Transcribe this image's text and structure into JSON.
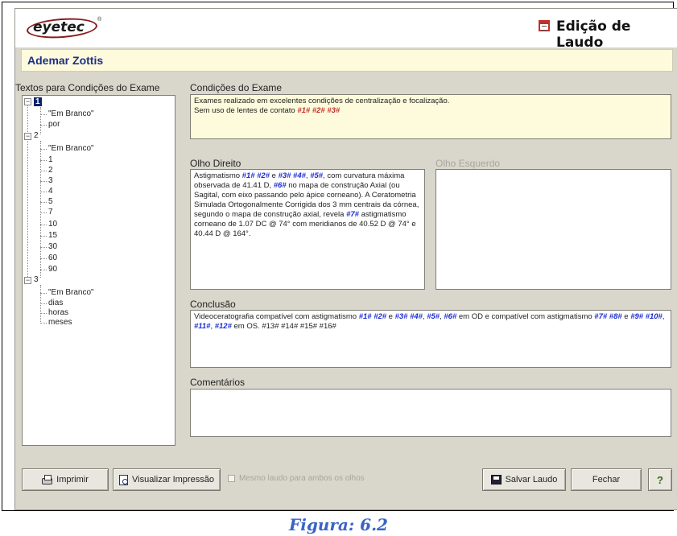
{
  "window": {
    "logo_text": "eyetec",
    "logo_reg": "®",
    "title": "Edição de Laudo",
    "user_name": "Ademar Zottis"
  },
  "tree_panel": {
    "label": "Textos para Condições do Exame",
    "nodes": [
      {
        "label": "1",
        "children": [
          "\"Em Branco\"",
          "por"
        ]
      },
      {
        "label": "2",
        "children": [
          "\"Em Branco\"",
          "1",
          "2",
          "3",
          "4",
          "5",
          "7",
          "10",
          "15",
          "30",
          "60",
          "90"
        ]
      },
      {
        "label": "3",
        "children": [
          "\"Em Branco\"",
          "dias",
          "horas",
          "meses"
        ]
      }
    ]
  },
  "condicoes": {
    "label": "Condições do Exame",
    "line1": "Exames realizado em excelentes condições de centralização e focalização.",
    "line2_prefix": "Sem uso de lentes de contato ",
    "line2_vars": "#1# #2# #3#"
  },
  "olho_direito": {
    "label": "Olho Direito",
    "t1": "Astigmatismo ",
    "v1": "#1# #2#",
    "t2": " e ",
    "v2": "#3# #4#",
    "t3": ", ",
    "v3": "#5#",
    "t4": ", com curvatura máxima observada de 41.41 D, ",
    "v4": "#6#",
    "t5": " no mapa de construção Axial (ou Sagital, com eixo passando pelo ápice corneano). A Ceratometria Simulada Ortogonalmente Corrigida dos 3 mm centrais da córnea, segundo o mapa de construção axial, revela ",
    "v5": "#7#",
    "t6": " astigmatismo corneano de 1.07 DC @ 74° com meridianos de 40.52 D @ 74° e 40.44 D @ 164°."
  },
  "olho_esquerdo": {
    "label": "Olho Esquerdo"
  },
  "conclusao": {
    "label": "Conclusão",
    "t1": "Videoceratografia compatível com astigmatismo ",
    "v1": "#1# #2#",
    "t2": " e ",
    "v2": "#3# #4#",
    "t3": ", ",
    "v3": "#5#",
    "t4": ", ",
    "v4": "#6#",
    "t5": " em OD e compatível com astigmatismo ",
    "v5": "#7# #8#",
    "t6": " e ",
    "v6": "#9# #10#",
    "t7": ", ",
    "v7": "#11#",
    "t8": ", ",
    "v8": "#12#",
    "t9": " em OS. #13# #14# #15# #16#"
  },
  "comentarios": {
    "label": "Comentários",
    "value": ""
  },
  "buttons": {
    "imprimir": "Imprimir",
    "visualizar": "Visualizar Impressão",
    "mesmo_laudo": "Mesmo laudo para ambos os olhos",
    "salvar": "Salvar Laudo",
    "fechar": "Fechar",
    "help": "?"
  },
  "caption": "Figura: 6.2"
}
